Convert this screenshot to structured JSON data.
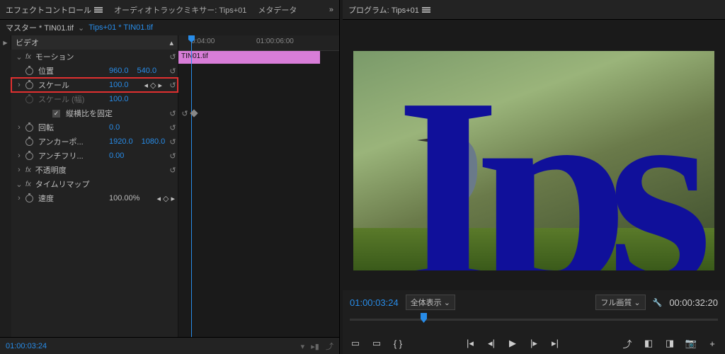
{
  "tabs": {
    "effect": "エフェクトコントロール",
    "mixer": "オーディオトラックミキサー: Tips+01",
    "meta": "メタデータ"
  },
  "sub": {
    "master": "マスター * TIN01.tif",
    "clip": "Tips+01 * TIN01.tif"
  },
  "ruler": {
    "t1": "0:04:00",
    "t2": "01:00:06:00"
  },
  "clip": "TIN01.tif",
  "sections": {
    "video": "ビデオ",
    "motion": "モーション",
    "opacity": "不透明度",
    "timeremap": "タイムリマップ"
  },
  "rows": {
    "position": {
      "lbl": "位置",
      "x": "960.0",
      "y": "540.0"
    },
    "scale": {
      "lbl": "スケール",
      "v": "100.0"
    },
    "scalew": {
      "lbl": "スケール (幅)",
      "v": "100.0"
    },
    "uniform": "縦横比を固定",
    "rotation": {
      "lbl": "回転",
      "v": "0.0"
    },
    "anchor": {
      "lbl": "アンカーポ...",
      "x": "1920.0",
      "y": "1080.0"
    },
    "antiflicker": {
      "lbl": "アンチフリ...",
      "v": "0.00"
    },
    "speed": {
      "lbl": "速度",
      "v": "100.00%"
    }
  },
  "bottom_tc": "01:00:03:24",
  "program": {
    "title": "プログラム: Tips+01"
  },
  "prog_ctrl": {
    "tc": "01:00:03:24",
    "fit": "全体表示",
    "quality": "フル画質",
    "dur": "00:00:32:20"
  },
  "letters": "Ips"
}
